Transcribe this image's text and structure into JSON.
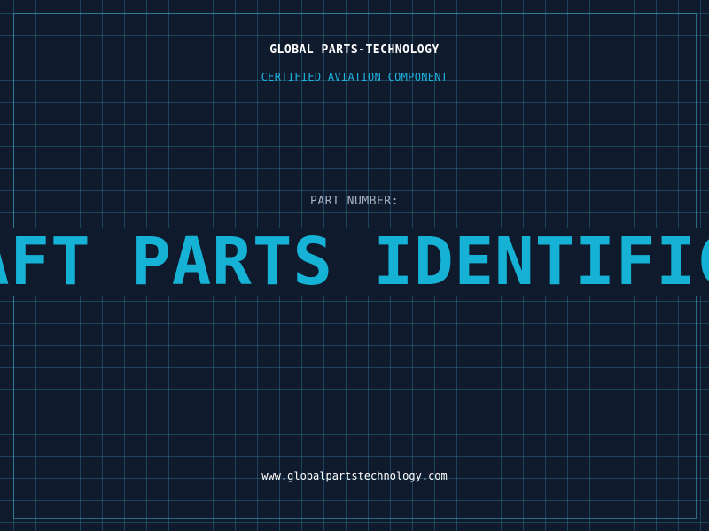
{
  "header": {
    "company": "GLOBAL PARTS-TECHNOLOGY",
    "tagline": "CERTIFIED AVIATION COMPONENT"
  },
  "part": {
    "label": "PART NUMBER:",
    "value": "AFT PARTS IDENTIFIC"
  },
  "footer": {
    "url": "www.globalpartstechnology.com"
  },
  "colors": {
    "background": "#0f1a2c",
    "grid": "#28788f",
    "accent": "#15b2d6",
    "text": "#ffffff",
    "muted": "#aab4c2"
  }
}
